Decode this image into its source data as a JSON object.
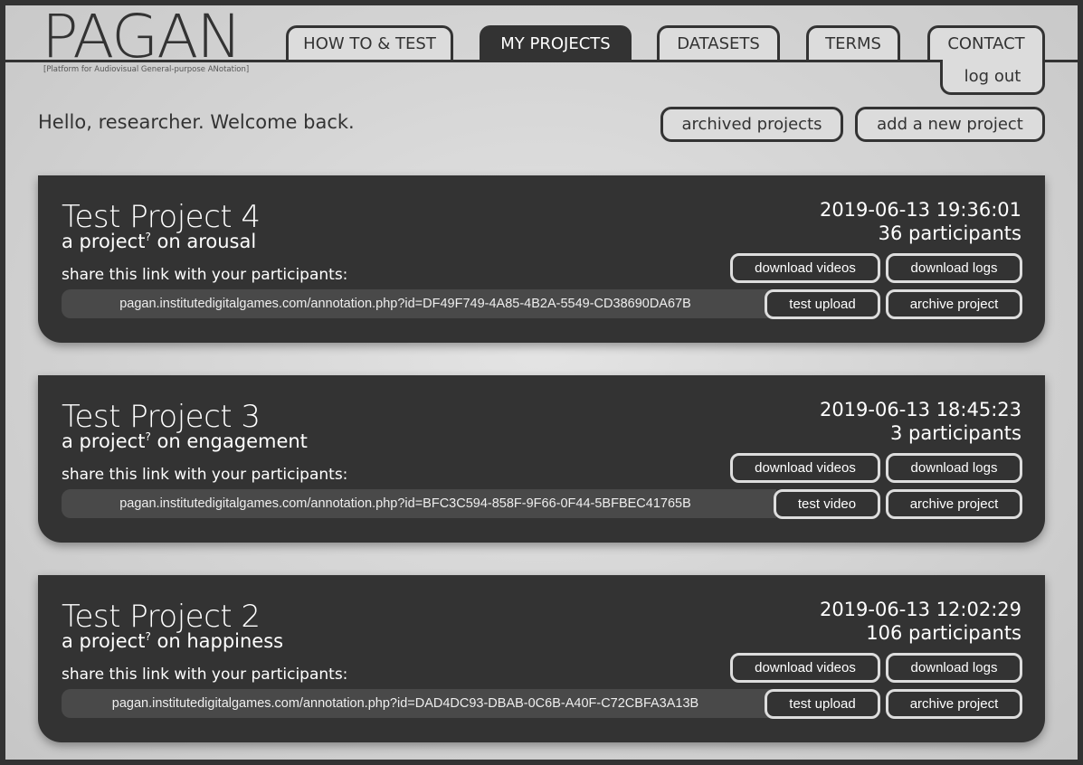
{
  "logo": {
    "title": "PAGAN",
    "subtitle": "[Platform for Audiovisual General-purpose ANotation]"
  },
  "nav": {
    "tabs": [
      {
        "label": "HOW TO & TEST",
        "active": false
      },
      {
        "label": "MY PROJECTS",
        "active": true
      },
      {
        "label": "DATASETS",
        "active": false
      },
      {
        "label": "TERMS",
        "active": false
      },
      {
        "label": "CONTACT",
        "active": false
      }
    ],
    "logout_label": "log out"
  },
  "welcome": "Hello, researcher. Welcome back.",
  "actions": {
    "archived_label": "archived projects",
    "add_label": "add a new project"
  },
  "projects": [
    {
      "title": "Test Project 4",
      "subtitle_prefix": "a project",
      "subtitle_mark": "?",
      "subtitle_suffix": " on arousal",
      "share_label": "share this link with your participants:",
      "link": "pagan.institutedigitalgames.com/annotation.php?id=DF49F749-4A85-4B2A-5549-CD38690DA67B",
      "date": "2019-06-13 19:36:01",
      "participants": "36 participants",
      "download_videos": "download videos",
      "download_logs": "download logs",
      "test_label": "test upload",
      "archive_label": "archive project"
    },
    {
      "title": "Test Project 3",
      "subtitle_prefix": "a project",
      "subtitle_mark": "?",
      "subtitle_suffix": " on engagement",
      "share_label": "share this link with your participants:",
      "link": "pagan.institutedigitalgames.com/annotation.php?id=BFC3C594-858F-9F66-0F44-5BFBEC41765B",
      "date": "2019-06-13 18:45:23",
      "participants": "3 participants",
      "download_videos": "download videos",
      "download_logs": "download logs",
      "test_label": "test video",
      "archive_label": "archive project"
    },
    {
      "title": "Test Project 2",
      "subtitle_prefix": "a project",
      "subtitle_mark": "?",
      "subtitle_suffix": " on happiness",
      "share_label": "share this link with your participants:",
      "link": "pagan.institutedigitalgames.com/annotation.php?id=DAD4DC93-DBAB-0C6B-A40F-C72CBFA3A13B",
      "date": "2019-06-13 12:02:29",
      "participants": "106 participants",
      "download_videos": "download videos",
      "download_logs": "download logs",
      "test_label": "test upload",
      "archive_label": "archive project"
    }
  ]
}
